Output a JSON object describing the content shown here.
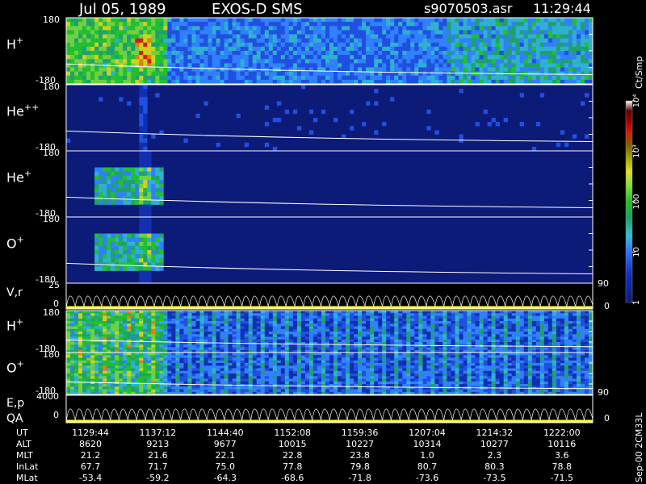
{
  "header": {
    "date": "Jul 05, 1989",
    "instrument": "EXOS-D SMS",
    "file": "s9070503.asr",
    "time": "11:29:44"
  },
  "colors": {
    "background": "#000000",
    "panel_bg": "#0c1a78",
    "trace": "#ffffff",
    "velocity_band": "#ffff40"
  },
  "chart_data": {
    "type": "heatmap",
    "colorbar": {
      "label": "Ct/Smp",
      "ticks": [
        {
          "label": "1",
          "value": 1
        },
        {
          "label": "10",
          "value": 10
        },
        {
          "label": "100",
          "value": 100
        },
        {
          "label": "10³",
          "value": 1000
        },
        {
          "label": "10⁴",
          "value": 10000
        }
      ],
      "range": [
        1,
        10000
      ],
      "scale": "log"
    },
    "panels": [
      {
        "label": "H",
        "sup": "+",
        "ymax_label": "180",
        "ymin_label": "-180",
        "intensity": "high"
      },
      {
        "label": "He",
        "sup": "++",
        "ymax_label": "180",
        "ymin_label": "-180",
        "intensity": "low"
      },
      {
        "label": "He",
        "sup": "+",
        "ymax_label": "180",
        "ymin_label": "-180",
        "intensity": "burst"
      },
      {
        "label": "O",
        "sup": "+",
        "ymax_label": "180",
        "ymin_label": "-180",
        "intensity": "burst"
      }
    ],
    "velocity_panel": {
      "label": "V,r",
      "left_max": "25",
      "left_min": "0",
      "right_max": "90",
      "right_min": "0"
    },
    "lower_panels": [
      {
        "label": "H",
        "sup": "+",
        "ymax_label": "180",
        "ymin_label": "-180"
      },
      {
        "label": "O",
        "sup": "+",
        "ymax_label": "180",
        "ymin_label": "-180"
      }
    ],
    "energy_panel": {
      "label1": "E,p",
      "label2": "QA",
      "left_max": "4000",
      "left_min": "0",
      "right_max": "90",
      "right_min": "0"
    },
    "ephemeris": {
      "row_labels": [
        "UT",
        "ALT",
        "MLT",
        "InLat",
        "MLat"
      ],
      "columns": [
        {
          "UT": "1129:44",
          "ALT": "8620",
          "MLT": "21.2",
          "InLat": "67.7",
          "MLat": "-53.4"
        },
        {
          "UT": "1137:12",
          "ALT": "9213",
          "MLT": "21.6",
          "InLat": "71.7",
          "MLat": "-59.2"
        },
        {
          "UT": "1144:40",
          "ALT": "9677",
          "MLT": "22.1",
          "InLat": "75.0",
          "MLat": "-64.3"
        },
        {
          "UT": "1152:08",
          "ALT": "10015",
          "MLT": "22.8",
          "InLat": "77.8",
          "MLat": "-68.6"
        },
        {
          "UT": "1159:36",
          "ALT": "10227",
          "MLT": "23.8",
          "InLat": "79.8",
          "MLat": "-71.8"
        },
        {
          "UT": "1207:04",
          "ALT": "10314",
          "MLT": "1.0",
          "InLat": "80.7",
          "MLat": "-73.6"
        },
        {
          "UT": "1214:32",
          "ALT": "10277",
          "MLT": "2.3",
          "InLat": "80.3",
          "MLat": "-73.5"
        },
        {
          "UT": "1222:00",
          "ALT": "10116",
          "MLT": "3.6",
          "InLat": "78.8",
          "MLat": "-71.5"
        }
      ]
    }
  },
  "footer_vertical": "Sep-00  2CM33L"
}
